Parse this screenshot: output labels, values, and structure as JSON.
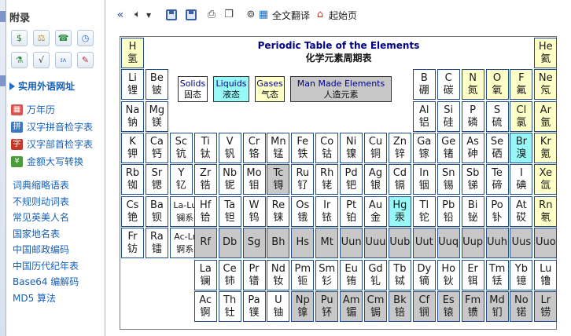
{
  "sidebar": {
    "title": "附录",
    "icon_rows": [
      [
        "currency-icon",
        "scale-icon",
        "phone-icon",
        "clock-icon"
      ],
      [
        "chemistry-icon",
        "formula-icon",
        "ipa-icon",
        "calligraphy-icon"
      ]
    ],
    "section_header": "实用外语网址",
    "tools": [
      {
        "label": "万年历",
        "icon": "calendar-icon",
        "color": "#d9534f"
      },
      {
        "label": "汉字拼音检字表",
        "icon": "pinyin-icon",
        "color": "#3a78c2"
      },
      {
        "label": "汉字部首检字表",
        "icon": "radical-icon",
        "color": "#c0392b"
      },
      {
        "label": "金额大写转换",
        "icon": "money-icon",
        "color": "#4a9b3a"
      }
    ],
    "links": [
      "词典缩略语表",
      "不规则动词表",
      "常见英美人名",
      "国家地名表",
      "中国邮政编码",
      "中国历代纪年表",
      "Base64 编解码",
      "MD5 算法"
    ]
  },
  "toolbar": {
    "translate_label": "全文翻译",
    "home_label": "起始页"
  },
  "periodic": {
    "title_en": "Periodic Table of the Elements",
    "title_cn": "化学元素周期表",
    "legend": {
      "solids_en": "Solids",
      "solids_cn": "固态",
      "liquids_en": "Liquids",
      "liquids_cn": "液态",
      "gases_en": "Gases",
      "gases_cn": "气态",
      "man_en": "Man Made Elements",
      "man_cn": "人造元素"
    },
    "colors": {
      "nonmetal": "#ffffc8",
      "liquid": "#98f8f8",
      "manmade": "#c8c8c8",
      "border": "#1f4e8c",
      "title": "#00008b"
    },
    "elements": [
      {
        "s": "H",
        "c": "氢",
        "col": 0,
        "row": 0,
        "t": "nonmetal"
      },
      {
        "s": "He",
        "c": "氦",
        "col": 17,
        "row": 0,
        "t": "nonmetal"
      },
      {
        "s": "Li",
        "c": "锂",
        "col": 0,
        "row": 1,
        "t": ""
      },
      {
        "s": "Be",
        "c": "铍",
        "col": 1,
        "row": 1,
        "t": ""
      },
      {
        "s": "B",
        "c": "硼",
        "col": 12,
        "row": 1,
        "t": ""
      },
      {
        "s": "C",
        "c": "碳",
        "col": 13,
        "row": 1,
        "t": ""
      },
      {
        "s": "N",
        "c": "氮",
        "col": 14,
        "row": 1,
        "t": "nonmetal"
      },
      {
        "s": "O",
        "c": "氧",
        "col": 15,
        "row": 1,
        "t": "nonmetal"
      },
      {
        "s": "F",
        "c": "氟",
        "col": 16,
        "row": 1,
        "t": "nonmetal"
      },
      {
        "s": "Ne",
        "c": "氖",
        "col": 17,
        "row": 1,
        "t": "nonmetal"
      },
      {
        "s": "Na",
        "c": "钠",
        "col": 0,
        "row": 2,
        "t": ""
      },
      {
        "s": "Mg",
        "c": "镁",
        "col": 1,
        "row": 2,
        "t": ""
      },
      {
        "s": "Al",
        "c": "铝",
        "col": 12,
        "row": 2,
        "t": ""
      },
      {
        "s": "Si",
        "c": "硅",
        "col": 13,
        "row": 2,
        "t": ""
      },
      {
        "s": "P",
        "c": "磷",
        "col": 14,
        "row": 2,
        "t": ""
      },
      {
        "s": "S",
        "c": "硫",
        "col": 15,
        "row": 2,
        "t": ""
      },
      {
        "s": "Cl",
        "c": "氯",
        "col": 16,
        "row": 2,
        "t": "nonmetal"
      },
      {
        "s": "Ar",
        "c": "氩",
        "col": 17,
        "row": 2,
        "t": "nonmetal"
      },
      {
        "s": "K",
        "c": "钾",
        "col": 0,
        "row": 3,
        "t": ""
      },
      {
        "s": "Ca",
        "c": "钙",
        "col": 1,
        "row": 3,
        "t": ""
      },
      {
        "s": "Sc",
        "c": "钪",
        "col": 2,
        "row": 3,
        "t": ""
      },
      {
        "s": "Ti",
        "c": "钛",
        "col": 3,
        "row": 3,
        "t": ""
      },
      {
        "s": "V",
        "c": "钒",
        "col": 4,
        "row": 3,
        "t": ""
      },
      {
        "s": "Cr",
        "c": "铬",
        "col": 5,
        "row": 3,
        "t": ""
      },
      {
        "s": "Mn",
        "c": "锰",
        "col": 6,
        "row": 3,
        "t": ""
      },
      {
        "s": "Fe",
        "c": "铁",
        "col": 7,
        "row": 3,
        "t": ""
      },
      {
        "s": "Co",
        "c": "钴",
        "col": 8,
        "row": 3,
        "t": ""
      },
      {
        "s": "Ni",
        "c": "镍",
        "col": 9,
        "row": 3,
        "t": ""
      },
      {
        "s": "Cu",
        "c": "铜",
        "col": 10,
        "row": 3,
        "t": ""
      },
      {
        "s": "Zn",
        "c": "锌",
        "col": 11,
        "row": 3,
        "t": ""
      },
      {
        "s": "Ga",
        "c": "镓",
        "col": 12,
        "row": 3,
        "t": ""
      },
      {
        "s": "Ge",
        "c": "锗",
        "col": 13,
        "row": 3,
        "t": ""
      },
      {
        "s": "As",
        "c": "砷",
        "col": 14,
        "row": 3,
        "t": ""
      },
      {
        "s": "Se",
        "c": "硒",
        "col": 15,
        "row": 3,
        "t": ""
      },
      {
        "s": "Br",
        "c": "溴",
        "col": 16,
        "row": 3,
        "t": "liquid"
      },
      {
        "s": "Kr",
        "c": "氪",
        "col": 17,
        "row": 3,
        "t": "nonmetal"
      },
      {
        "s": "Rb",
        "c": "铷",
        "col": 0,
        "row": 4,
        "t": ""
      },
      {
        "s": "Sr",
        "c": "锶",
        "col": 1,
        "row": 4,
        "t": ""
      },
      {
        "s": "Y",
        "c": "钇",
        "col": 2,
        "row": 4,
        "t": ""
      },
      {
        "s": "Zr",
        "c": "锆",
        "col": 3,
        "row": 4,
        "t": ""
      },
      {
        "s": "Nb",
        "c": "铌",
        "col": 4,
        "row": 4,
        "t": ""
      },
      {
        "s": "Mo",
        "c": "钼",
        "col": 5,
        "row": 4,
        "t": ""
      },
      {
        "s": "Tc",
        "c": "锝",
        "col": 6,
        "row": 4,
        "t": "manmade"
      },
      {
        "s": "Ru",
        "c": "钌",
        "col": 7,
        "row": 4,
        "t": ""
      },
      {
        "s": "Rh",
        "c": "铑",
        "col": 8,
        "row": 4,
        "t": ""
      },
      {
        "s": "Pd",
        "c": "钯",
        "col": 9,
        "row": 4,
        "t": ""
      },
      {
        "s": "Ag",
        "c": "银",
        "col": 10,
        "row": 4,
        "t": ""
      },
      {
        "s": "Cd",
        "c": "镉",
        "col": 11,
        "row": 4,
        "t": ""
      },
      {
        "s": "In",
        "c": "铟",
        "col": 12,
        "row": 4,
        "t": ""
      },
      {
        "s": "Sn",
        "c": "锡",
        "col": 13,
        "row": 4,
        "t": ""
      },
      {
        "s": "Sb",
        "c": "锑",
        "col": 14,
        "row": 4,
        "t": ""
      },
      {
        "s": "Te",
        "c": "碲",
        "col": 15,
        "row": 4,
        "t": ""
      },
      {
        "s": "I",
        "c": "碘",
        "col": 16,
        "row": 4,
        "t": ""
      },
      {
        "s": "Xe",
        "c": "氙",
        "col": 17,
        "row": 4,
        "t": "nonmetal"
      },
      {
        "s": "Cs",
        "c": "铯",
        "col": 0,
        "row": 5,
        "t": ""
      },
      {
        "s": "Ba",
        "c": "钡",
        "col": 1,
        "row": 5,
        "t": ""
      },
      {
        "s": "La-Lu",
        "c": "镧系",
        "col": 2,
        "row": 5,
        "t": "",
        "w": 1
      },
      {
        "s": "Hf",
        "c": "铪",
        "col": 3,
        "row": 5,
        "t": ""
      },
      {
        "s": "Ta",
        "c": "钽",
        "col": 4,
        "row": 5,
        "t": ""
      },
      {
        "s": "W",
        "c": "钨",
        "col": 5,
        "row": 5,
        "t": ""
      },
      {
        "s": "Re",
        "c": "铼",
        "col": 6,
        "row": 5,
        "t": ""
      },
      {
        "s": "Os",
        "c": "锇",
        "col": 7,
        "row": 5,
        "t": ""
      },
      {
        "s": "Ir",
        "c": "铱",
        "col": 8,
        "row": 5,
        "t": ""
      },
      {
        "s": "Pt",
        "c": "铂",
        "col": 9,
        "row": 5,
        "t": ""
      },
      {
        "s": "Au",
        "c": "金",
        "col": 10,
        "row": 5,
        "t": ""
      },
      {
        "s": "Hg",
        "c": "汞",
        "col": 11,
        "row": 5,
        "t": "liquid"
      },
      {
        "s": "Tl",
        "c": "铊",
        "col": 12,
        "row": 5,
        "t": ""
      },
      {
        "s": "Pb",
        "c": "铅",
        "col": 13,
        "row": 5,
        "t": ""
      },
      {
        "s": "Bi",
        "c": "铋",
        "col": 14,
        "row": 5,
        "t": ""
      },
      {
        "s": "Po",
        "c": "钋",
        "col": 15,
        "row": 5,
        "t": ""
      },
      {
        "s": "At",
        "c": "砹",
        "col": 16,
        "row": 5,
        "t": ""
      },
      {
        "s": "Rn",
        "c": "氡",
        "col": 17,
        "row": 5,
        "t": "nonmetal"
      },
      {
        "s": "Fr",
        "c": "钫",
        "col": 0,
        "row": 6,
        "t": ""
      },
      {
        "s": "Ra",
        "c": "镭",
        "col": 1,
        "row": 6,
        "t": ""
      },
      {
        "s": "Ac-Lr",
        "c": "锕系",
        "col": 2,
        "row": 6,
        "t": "",
        "w": 1
      },
      {
        "s": "Rf",
        "c": "",
        "col": 3,
        "row": 6,
        "t": "manmade"
      },
      {
        "s": "Db",
        "c": "",
        "col": 4,
        "row": 6,
        "t": "manmade"
      },
      {
        "s": "Sg",
        "c": "",
        "col": 5,
        "row": 6,
        "t": "manmade"
      },
      {
        "s": "Bh",
        "c": "",
        "col": 6,
        "row": 6,
        "t": "manmade"
      },
      {
        "s": "Hs",
        "c": "",
        "col": 7,
        "row": 6,
        "t": "manmade"
      },
      {
        "s": "Mt",
        "c": "",
        "col": 8,
        "row": 6,
        "t": "manmade"
      },
      {
        "s": "Uun",
        "c": "",
        "col": 9,
        "row": 6,
        "t": "manmade"
      },
      {
        "s": "Uuu",
        "c": "",
        "col": 10,
        "row": 6,
        "t": "manmade"
      },
      {
        "s": "Uub",
        "c": "",
        "col": 11,
        "row": 6,
        "t": "manmade"
      },
      {
        "s": "Uut",
        "c": "",
        "col": 12,
        "row": 6,
        "t": "manmade"
      },
      {
        "s": "Uuq",
        "c": "",
        "col": 13,
        "row": 6,
        "t": "manmade"
      },
      {
        "s": "Uup",
        "c": "",
        "col": 14,
        "row": 6,
        "t": "manmade"
      },
      {
        "s": "Uuh",
        "c": "",
        "col": 15,
        "row": 6,
        "t": "manmade"
      },
      {
        "s": "Uus",
        "c": "",
        "col": 16,
        "row": 6,
        "t": "manmade"
      },
      {
        "s": "Uuo",
        "c": "",
        "col": 17,
        "row": 6,
        "t": "manmade"
      },
      {
        "s": "La",
        "c": "镧",
        "col": 3,
        "row": 7,
        "t": ""
      },
      {
        "s": "Ce",
        "c": "铈",
        "col": 4,
        "row": 7,
        "t": ""
      },
      {
        "s": "Pr",
        "c": "镨",
        "col": 5,
        "row": 7,
        "t": ""
      },
      {
        "s": "Nd",
        "c": "钕",
        "col": 6,
        "row": 7,
        "t": ""
      },
      {
        "s": "Pm",
        "c": "钷",
        "col": 7,
        "row": 7,
        "t": ""
      },
      {
        "s": "Sm",
        "c": "钐",
        "col": 8,
        "row": 7,
        "t": ""
      },
      {
        "s": "Eu",
        "c": "铕",
        "col": 9,
        "row": 7,
        "t": ""
      },
      {
        "s": "Gd",
        "c": "钆",
        "col": 10,
        "row": 7,
        "t": ""
      },
      {
        "s": "Tb",
        "c": "铽",
        "col": 11,
        "row": 7,
        "t": ""
      },
      {
        "s": "Dy",
        "c": "镝",
        "col": 12,
        "row": 7,
        "t": ""
      },
      {
        "s": "Ho",
        "c": "钬",
        "col": 13,
        "row": 7,
        "t": ""
      },
      {
        "s": "Er",
        "c": "铒",
        "col": 14,
        "row": 7,
        "t": ""
      },
      {
        "s": "Tm",
        "c": "铥",
        "col": 15,
        "row": 7,
        "t": ""
      },
      {
        "s": "Yb",
        "c": "镱",
        "col": 16,
        "row": 7,
        "t": ""
      },
      {
        "s": "Lu",
        "c": "镥",
        "col": 17,
        "row": 7,
        "t": ""
      },
      {
        "s": "Ac",
        "c": "锕",
        "col": 3,
        "row": 8,
        "t": ""
      },
      {
        "s": "Th",
        "c": "钍",
        "col": 4,
        "row": 8,
        "t": ""
      },
      {
        "s": "Pa",
        "c": "镤",
        "col": 5,
        "row": 8,
        "t": ""
      },
      {
        "s": "U",
        "c": "铀",
        "col": 6,
        "row": 8,
        "t": ""
      },
      {
        "s": "Np",
        "c": "镎",
        "col": 7,
        "row": 8,
        "t": "manmade"
      },
      {
        "s": "Pu",
        "c": "钚",
        "col": 8,
        "row": 8,
        "t": "manmade"
      },
      {
        "s": "Am",
        "c": "镅",
        "col": 9,
        "row": 8,
        "t": "manmade"
      },
      {
        "s": "Cm",
        "c": "锔",
        "col": 10,
        "row": 8,
        "t": "manmade"
      },
      {
        "s": "Bk",
        "c": "锫",
        "col": 11,
        "row": 8,
        "t": "manmade"
      },
      {
        "s": "Cf",
        "c": "锎",
        "col": 12,
        "row": 8,
        "t": "manmade"
      },
      {
        "s": "Es",
        "c": "锿",
        "col": 13,
        "row": 8,
        "t": "manmade"
      },
      {
        "s": "Fm",
        "c": "镄",
        "col": 14,
        "row": 8,
        "t": "manmade"
      },
      {
        "s": "Md",
        "c": "钔",
        "col": 15,
        "row": 8,
        "t": "manmade"
      },
      {
        "s": "No",
        "c": "锘",
        "col": 16,
        "row": 8,
        "t": "manmade"
      },
      {
        "s": "Lr",
        "c": "铹",
        "col": 17,
        "row": 8,
        "t": "manmade"
      }
    ]
  }
}
